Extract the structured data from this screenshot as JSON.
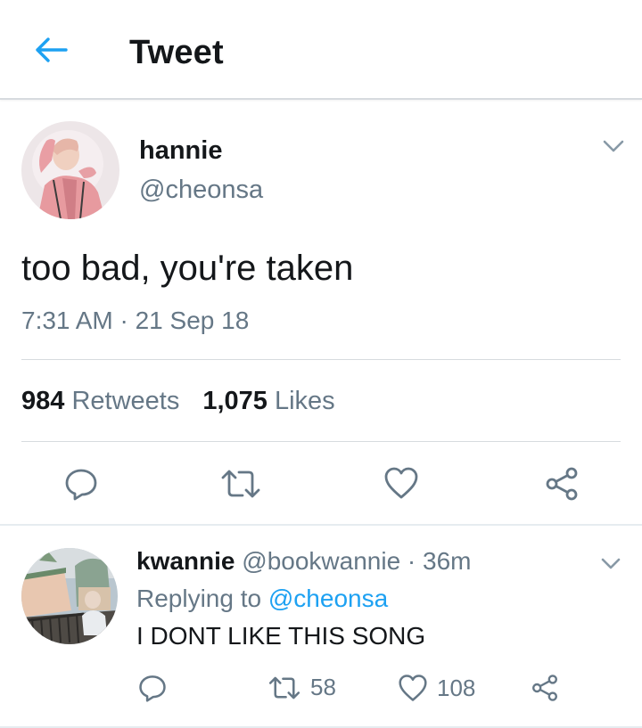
{
  "header": {
    "title": "Tweet",
    "back_icon": "arrow-left-icon"
  },
  "colors": {
    "accent": "#1da1f2",
    "text": "#14171a",
    "muted": "#657786",
    "divider": "#e6ecf0"
  },
  "main_tweet": {
    "display_name": "hannie",
    "handle": "@cheonsa",
    "text": "too bad, you're taken",
    "timestamp": "7:31 AM · 21 Sep 18",
    "retweet_count": "984",
    "retweet_label": "Retweets",
    "like_count": "1,075",
    "like_label": "Likes",
    "actions": [
      "reply-icon",
      "retweet-icon",
      "like-icon",
      "share-icon"
    ]
  },
  "reply_tweet": {
    "display_name": "kwannie",
    "handle_time": "@bookwannie · 36m",
    "replying_prefix": "Replying to",
    "replying_handle": "@cheonsa",
    "text": "I DONT LIKE THIS SONG",
    "retweet_count": "58",
    "like_count": "108"
  }
}
